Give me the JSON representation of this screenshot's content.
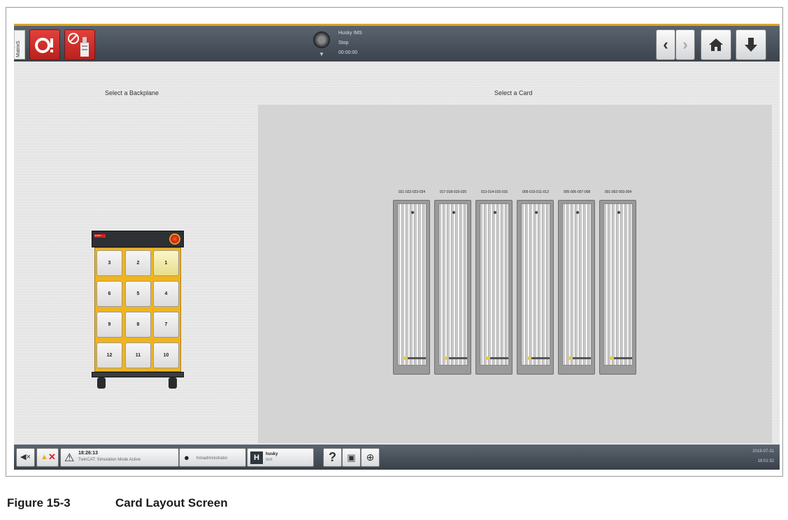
{
  "side_tab": "MatrixS",
  "status": {
    "line1": "Husky IMS",
    "line2": "Stop",
    "line3": "00:00:00"
  },
  "titles": {
    "left": "Select a Backplane",
    "right": "Select a Card"
  },
  "backplane": {
    "logo_text": "HUSKY",
    "slots": [
      {
        "label": "3",
        "active": false
      },
      {
        "label": "2",
        "active": false
      },
      {
        "label": "1",
        "active": true
      },
      {
        "label": "6",
        "active": false
      },
      {
        "label": "5",
        "active": false
      },
      {
        "label": "4",
        "active": false
      },
      {
        "label": "9",
        "active": false
      },
      {
        "label": "8",
        "active": false
      },
      {
        "label": "7",
        "active": false
      },
      {
        "label": "12",
        "active": false
      },
      {
        "label": "11",
        "active": false
      },
      {
        "label": "10",
        "active": false
      }
    ]
  },
  "cards": [
    {
      "label": "021-022-023-024"
    },
    {
      "label": "017-018-019-020"
    },
    {
      "label": "013-014-015-016"
    },
    {
      "label": "009-010-011-012"
    },
    {
      "label": "005-006-007-008"
    },
    {
      "label": "001-002-003-004"
    }
  ],
  "statusbar": {
    "message_time": "18:26:13",
    "message_text": "TwinCAT: Simulation Mode Active",
    "user": "hmiadministrator",
    "machine_name": "husky",
    "machine_sub": "test",
    "date": "2019-07-31",
    "time": "18:01:32"
  },
  "icons": {
    "mute": "speaker-mute-icon",
    "help": "question-icon",
    "screenshot": "screenshot-icon",
    "language": "globe-icon"
  },
  "caption": {
    "number": "Figure 15-3",
    "title": "Card Layout Screen"
  }
}
